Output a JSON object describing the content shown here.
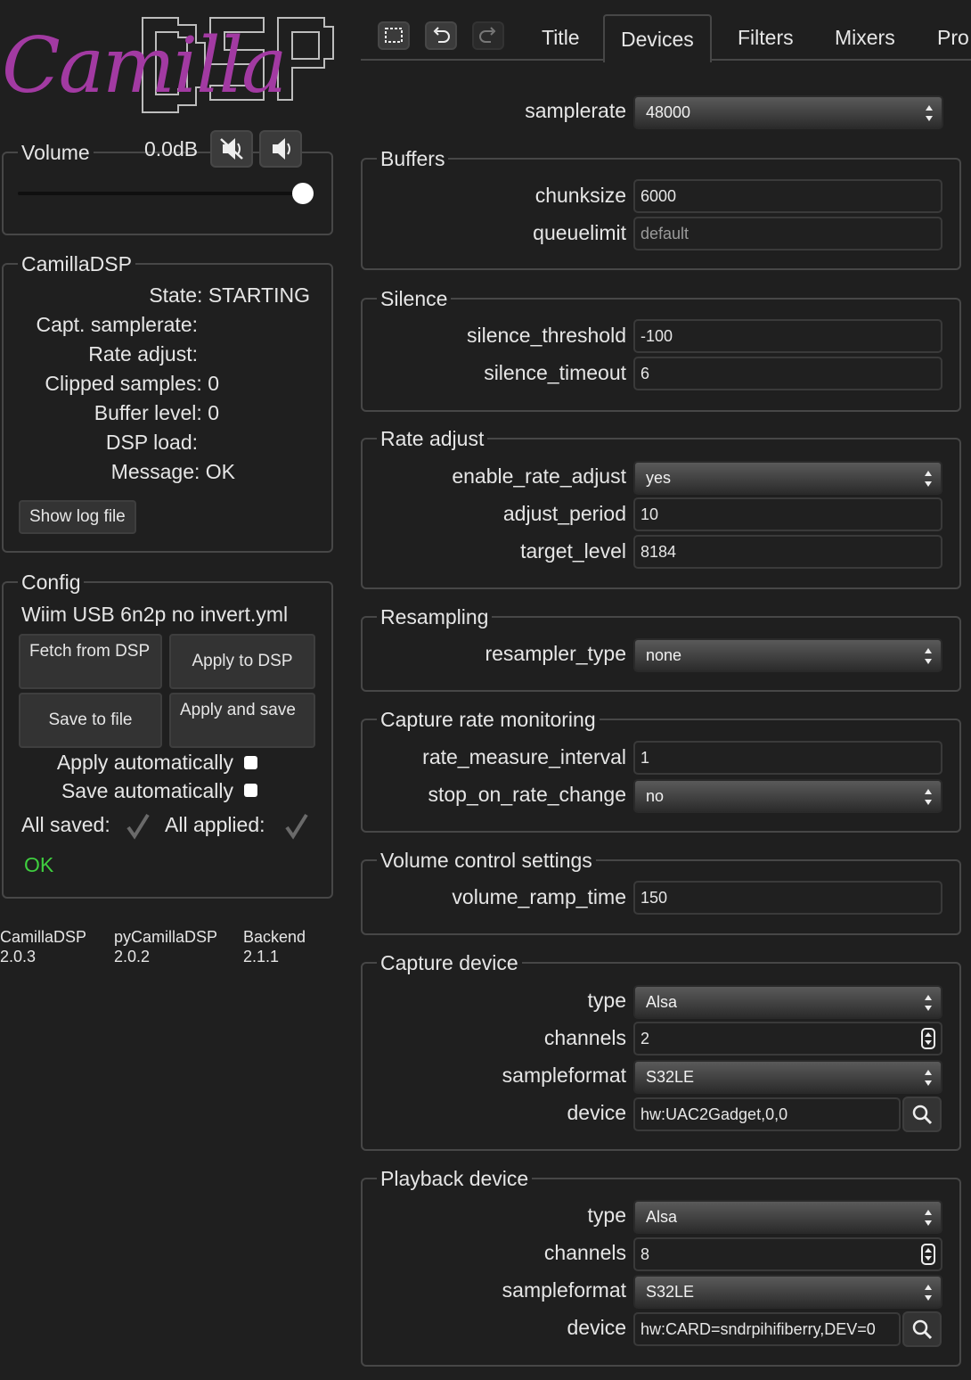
{
  "app": {
    "logo_script": "Camilla",
    "logo_block": "DSP"
  },
  "toolbar": {
    "icons": [
      "select-all-icon",
      "undo-icon",
      "redo-icon"
    ]
  },
  "tabs": [
    "Title",
    "Devices",
    "Filters",
    "Mixers",
    "Pro"
  ],
  "active_tab": "Devices",
  "volume": {
    "label": "Volume",
    "value": "0.0dB",
    "slider_fraction": 1.0
  },
  "status": {
    "legend": "CamillaDSP",
    "rows": [
      {
        "label": "State:",
        "value": "STARTING"
      },
      {
        "label": "Capt. samplerate:",
        "value": ""
      },
      {
        "label": "Rate adjust:",
        "value": ""
      },
      {
        "label": "Clipped samples:",
        "value": "0"
      },
      {
        "label": "Buffer level:",
        "value": "0"
      },
      {
        "label": "DSP load:",
        "value": ""
      },
      {
        "label": "Message:",
        "value": "OK"
      }
    ],
    "show_log": "Show log file"
  },
  "config": {
    "legend": "Config",
    "filename": "Wiim USB 6n2p no invert.yml",
    "fetch": "Fetch from DSP",
    "apply": "Apply to DSP",
    "save": "Save to file",
    "apply_save": "Apply and save",
    "apply_auto": "Apply automatically",
    "save_auto": "Save automatically",
    "all_saved": "All saved:",
    "all_applied": "All applied:",
    "ok": "OK",
    "ok_color": "#3fce3f"
  },
  "versions": [
    {
      "name": "CamillaDSP",
      "ver": "2.0.3"
    },
    {
      "name": "pyCamillaDSP",
      "ver": "2.0.2"
    },
    {
      "name": "Backend",
      "ver": "2.1.1"
    }
  ],
  "devices": {
    "samplerate": {
      "label": "samplerate",
      "value": "48000"
    },
    "buffers": {
      "legend": "Buffers",
      "chunksize": {
        "label": "chunksize",
        "value": "6000"
      },
      "queuelimit": {
        "label": "queuelimit",
        "placeholder": "default"
      }
    },
    "silence": {
      "legend": "Silence",
      "threshold": {
        "label": "silence_threshold",
        "value": "-100"
      },
      "timeout": {
        "label": "silence_timeout",
        "value": "6"
      }
    },
    "rate_adjust": {
      "legend": "Rate adjust",
      "enable": {
        "label": "enable_rate_adjust",
        "value": "yes"
      },
      "period": {
        "label": "adjust_period",
        "value": "10"
      },
      "target": {
        "label": "target_level",
        "value": "8184"
      }
    },
    "resampling": {
      "legend": "Resampling",
      "type": {
        "label": "resampler_type",
        "value": "none"
      }
    },
    "capture_rate": {
      "legend": "Capture rate monitoring",
      "interval": {
        "label": "rate_measure_interval",
        "value": "1"
      },
      "stop": {
        "label": "stop_on_rate_change",
        "value": "no"
      }
    },
    "volume_ctl": {
      "legend": "Volume control settings",
      "ramp": {
        "label": "volume_ramp_time",
        "value": "150"
      }
    },
    "capture": {
      "legend": "Capture device",
      "type": {
        "label": "type",
        "value": "Alsa"
      },
      "channels": {
        "label": "channels",
        "value": "2"
      },
      "format": {
        "label": "sampleformat",
        "value": "S32LE"
      },
      "device": {
        "label": "device",
        "value": "hw:UAC2Gadget,0,0"
      }
    },
    "playback": {
      "legend": "Playback device",
      "type": {
        "label": "type",
        "value": "Alsa"
      },
      "channels": {
        "label": "channels",
        "value": "8"
      },
      "format": {
        "label": "sampleformat",
        "value": "S32LE"
      },
      "device": {
        "label": "device",
        "value": "hw:CARD=sndrpihifiberry,DEV=0"
      }
    }
  }
}
